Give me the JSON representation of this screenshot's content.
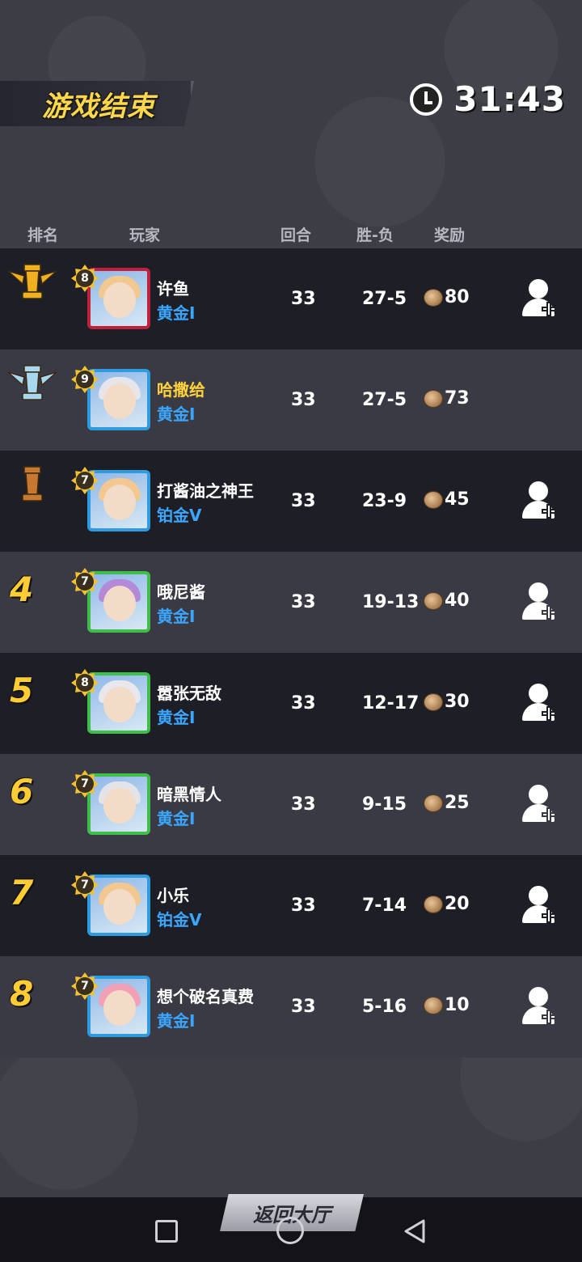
{
  "header": {
    "title": "游戏结束",
    "timer": "31:43"
  },
  "columns": {
    "rank": "排名",
    "player": "玩家",
    "rounds": "回合",
    "winloss": "胜-负",
    "reward": "奖励"
  },
  "players": [
    {
      "rank": "1",
      "trophy": "gold-trophy",
      "level": "8",
      "name": "许鱼",
      "tier": "黄金I",
      "rounds": "33",
      "winloss": "27-5",
      "reward": "80",
      "avatar_frame": "#c0203a",
      "hair": "#f0c890",
      "add_friend": true,
      "name_gold": false
    },
    {
      "rank": "2",
      "trophy": "silver-trophy",
      "level": "9",
      "name": "哈撒给",
      "tier": "黄金I",
      "rounds": "33",
      "winloss": "27-5",
      "reward": "73",
      "avatar_frame": "#2f9be0",
      "hair": "#e6e6ea",
      "add_friend": false,
      "name_gold": true
    },
    {
      "rank": "3",
      "trophy": "bronze-trophy",
      "level": "7",
      "name": "打酱油之神王",
      "tier": "铂金V",
      "rounds": "33",
      "winloss": "23-9",
      "reward": "45",
      "avatar_frame": "#2f9be0",
      "hair": "#f2c890",
      "add_friend": true,
      "name_gold": false
    },
    {
      "rank": "4",
      "trophy": "",
      "level": "7",
      "name": "哦尼酱",
      "tier": "黄金I",
      "rounds": "33",
      "winloss": "19-13",
      "reward": "40",
      "avatar_frame": "#3fbf4a",
      "hair": "#b48ad8",
      "add_friend": true,
      "name_gold": false
    },
    {
      "rank": "5",
      "trophy": "",
      "level": "8",
      "name": "嚣张无敌",
      "tier": "黄金I",
      "rounds": "33",
      "winloss": "12-17",
      "reward": "30",
      "avatar_frame": "#3fbf4a",
      "hair": "#e8e8ec",
      "add_friend": true,
      "name_gold": false
    },
    {
      "rank": "6",
      "trophy": "",
      "level": "7",
      "name": "暗黑情人",
      "tier": "黄金I",
      "rounds": "33",
      "winloss": "9-15",
      "reward": "25",
      "avatar_frame": "#3fbf4a",
      "hair": "#e4e4e8",
      "add_friend": true,
      "name_gold": false
    },
    {
      "rank": "7",
      "trophy": "",
      "level": "7",
      "name": "小乐",
      "tier": "铂金V",
      "rounds": "33",
      "winloss": "7-14",
      "reward": "20",
      "avatar_frame": "#2f9be0",
      "hair": "#f2c890",
      "add_friend": true,
      "name_gold": false
    },
    {
      "rank": "8",
      "trophy": "",
      "level": "7",
      "name": "想个破名真费",
      "tier": "黄金I",
      "rounds": "33",
      "winloss": "5-16",
      "reward": "10",
      "avatar_frame": "#2f9be0",
      "hair": "#f2a0b8",
      "add_friend": true,
      "name_gold": false
    }
  ],
  "footer": {
    "return_label": "返回大厅"
  },
  "colors": {
    "gold_text": "#ffd23a",
    "tier_blue": "#3aa6ff",
    "trophy_gold": "#f0b020",
    "trophy_silver": "#a8d8f0",
    "trophy_bronze": "#c87830"
  }
}
